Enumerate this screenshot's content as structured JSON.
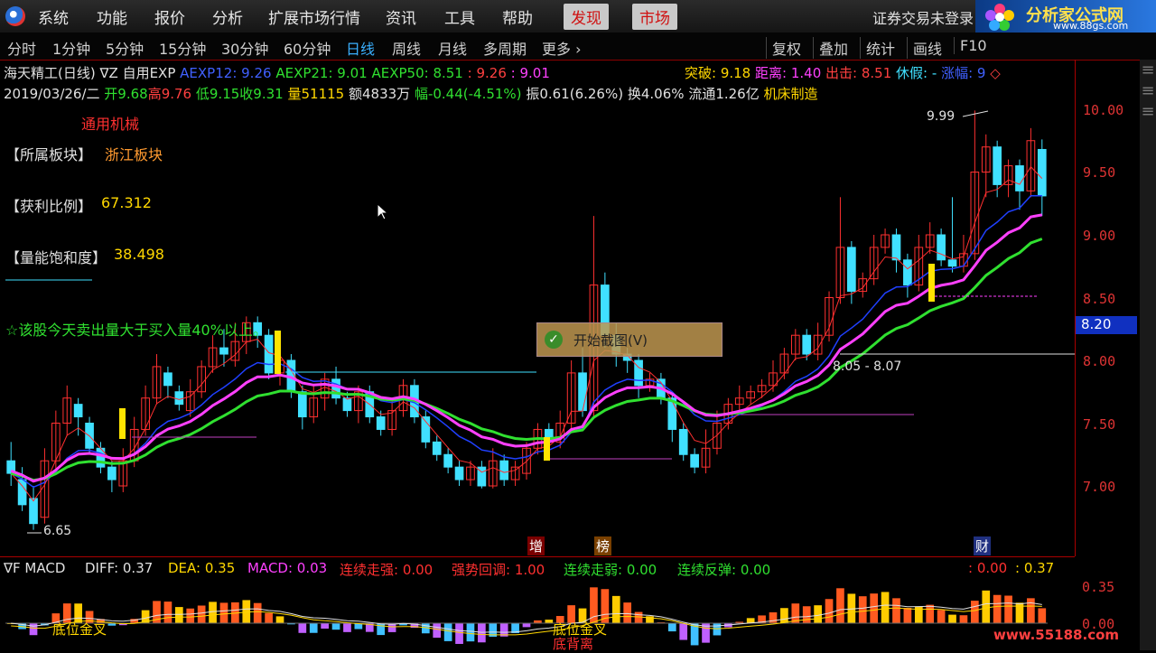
{
  "menubar": {
    "items": [
      "系统",
      "功能",
      "报价",
      "分析",
      "扩展市场行情",
      "资讯",
      "工具",
      "帮助"
    ],
    "highlighted": [
      "发现",
      "市场"
    ],
    "status": "证券交易未登录"
  },
  "brand": {
    "title": "分析家公式网",
    "url": "www.88gs.com"
  },
  "toolbar": {
    "periods": [
      "分时",
      "1分钟",
      "5分钟",
      "15分钟",
      "30分钟",
      "60分钟",
      "日线",
      "周线",
      "月线",
      "多周期",
      "更多 ›"
    ],
    "active": "日线",
    "right": [
      "复权",
      "叠加",
      "统计",
      "画线",
      "F10"
    ]
  },
  "info": {
    "name": "海天精工(日线)",
    "formula": "∇Z 自用EXP",
    "aexp12": "AEXP12: 9.26",
    "aexp21": "AEXP21: 9.01",
    "aexp50": "AEXP50: 8.51",
    "v1": ": 9.26",
    "v2": ": 9.01",
    "breakout": "突破: 9.18",
    "distance": "距离: 1.40",
    "exit": "出击: 8.51",
    "holiday": "休假: -",
    "rise": "涨幅: 9",
    "date": "2019/03/26/二",
    "open": "开9.68",
    "high": "高9.76",
    "low": "低9.15",
    "close": "收9.31",
    "volume": "量51115",
    "amount": "额4833万",
    "change": "幅-0.44(-4.51%)",
    "amp": "振0.61(6.26%)",
    "turnover": "换4.06%",
    "float": "流通1.26亿",
    "industry": "机床制造",
    "sector_tag": "通用机械"
  },
  "labels": {
    "sector": "【所属板块】",
    "sector_val": "浙江板块",
    "profit": "【获利比例】",
    "profit_val": "67.312",
    "vol_sat": "【量能饱和度】",
    "vol_sat_val": "38.498",
    "note": "☆该股今天卖出量大于买入量40%以上。"
  },
  "annotations": {
    "high_label": "9.99",
    "low_label": "6.65",
    "range_label": "8.05 - 8.07",
    "m_add": "增",
    "m_list": "榜",
    "m_fin": "财"
  },
  "price_axis": [
    "10.00",
    "9.50",
    "9.00",
    "8.50",
    "8.00",
    "7.50",
    "7.00"
  ],
  "price_tag": "8.20",
  "popup": {
    "label": "开始截图(V)"
  },
  "macd": {
    "title": "∇F MACD",
    "diff": "DIFF: 0.37",
    "dea": "DEA: 0.35",
    "macd": "MACD: 0.03",
    "s1": "连续走强: 0.00",
    "s2": "强势回调: 1.00",
    "s3": "连续走弱: 0.00",
    "s4": "连续反弹: 0.00",
    "r1": ": 0.00",
    "r2": ": 0.37",
    "ticks": [
      "0.35",
      "0.00"
    ],
    "tag1": "底位金叉",
    "tag2": "底位金叉",
    "tag3": "底背离"
  },
  "watermark": "www.55188.com",
  "colors": {
    "up": "#ff3030",
    "down": "#40e0ff",
    "ma_green": "#30e030",
    "ma_pink": "#ff40ff",
    "ma_blue": "#2040ff"
  },
  "chart_data": {
    "type": "candlestick",
    "ylim": [
      6.5,
      10.2
    ],
    "candles": [
      [
        7.2,
        7.1,
        7.35,
        7.0
      ],
      [
        7.05,
        6.85,
        7.15,
        6.8
      ],
      [
        6.9,
        6.7,
        7.0,
        6.65
      ],
      [
        6.75,
        7.2,
        7.3,
        6.7
      ],
      [
        7.2,
        7.5,
        7.6,
        7.1
      ],
      [
        7.5,
        7.7,
        7.8,
        7.4
      ],
      [
        7.65,
        7.55,
        7.7,
        7.4
      ],
      [
        7.5,
        7.3,
        7.55,
        7.25
      ],
      [
        7.3,
        7.15,
        7.35,
        7.1
      ],
      [
        7.15,
        7.05,
        7.2,
        6.95
      ],
      [
        7.0,
        7.2,
        7.3,
        6.95
      ],
      [
        7.2,
        7.45,
        7.55,
        7.15
      ],
      [
        7.45,
        7.7,
        7.8,
        7.4
      ],
      [
        7.7,
        7.95,
        8.05,
        7.65
      ],
      [
        7.9,
        7.8,
        7.95,
        7.7
      ],
      [
        7.75,
        7.65,
        7.8,
        7.6
      ],
      [
        7.6,
        7.75,
        7.85,
        7.55
      ],
      [
        7.75,
        7.95,
        8.0,
        7.7
      ],
      [
        7.95,
        8.1,
        8.2,
        7.9
      ],
      [
        8.1,
        8.05,
        8.25,
        7.95
      ],
      [
        8.0,
        8.15,
        8.3,
        7.95
      ],
      [
        8.15,
        8.3,
        8.35,
        8.05
      ],
      [
        8.3,
        8.2,
        8.35,
        8.1
      ],
      [
        8.2,
        7.9,
        8.25,
        7.85
      ],
      [
        7.9,
        8.0,
        8.1,
        7.8
      ],
      [
        8.0,
        7.75,
        8.05,
        7.7
      ],
      [
        7.75,
        7.55,
        7.8,
        7.45
      ],
      [
        7.55,
        7.7,
        7.8,
        7.5
      ],
      [
        7.7,
        7.85,
        7.9,
        7.6
      ],
      [
        7.85,
        7.7,
        7.95,
        7.65
      ],
      [
        7.7,
        7.6,
        7.75,
        7.55
      ],
      [
        7.6,
        7.75,
        7.8,
        7.5
      ],
      [
        7.75,
        7.55,
        7.8,
        7.5
      ],
      [
        7.55,
        7.45,
        7.6,
        7.4
      ],
      [
        7.45,
        7.6,
        7.7,
        7.4
      ],
      [
        7.6,
        7.8,
        7.85,
        7.55
      ],
      [
        7.8,
        7.55,
        7.85,
        7.5
      ],
      [
        7.55,
        7.35,
        7.6,
        7.3
      ],
      [
        7.35,
        7.25,
        7.4,
        7.2
      ],
      [
        7.25,
        7.15,
        7.3,
        7.1
      ],
      [
        7.15,
        7.05,
        7.2,
        7.0
      ],
      [
        7.05,
        7.15,
        7.2,
        7.0
      ],
      [
        7.15,
        7.0,
        7.2,
        6.98
      ],
      [
        7.0,
        7.2,
        7.3,
        6.98
      ],
      [
        7.2,
        7.05,
        7.25,
        7.0
      ],
      [
        7.05,
        7.15,
        7.2,
        7.0
      ],
      [
        7.1,
        7.3,
        7.35,
        7.05
      ],
      [
        7.3,
        7.45,
        7.5,
        7.25
      ],
      [
        7.45,
        7.35,
        7.5,
        7.3
      ],
      [
        7.35,
        7.5,
        7.6,
        7.3
      ],
      [
        7.5,
        7.9,
        8.0,
        7.45
      ],
      [
        7.9,
        7.6,
        8.1,
        7.55
      ],
      [
        7.6,
        8.6,
        9.15,
        7.55
      ],
      [
        8.6,
        8.2,
        8.7,
        8.1
      ],
      [
        8.2,
        8.05,
        8.3,
        7.95
      ],
      [
        8.05,
        8.0,
        8.1,
        7.9
      ],
      [
        8.0,
        7.8,
        8.05,
        7.7
      ],
      [
        7.8,
        7.85,
        7.9,
        7.75
      ],
      [
        7.85,
        7.7,
        7.9,
        7.65
      ],
      [
        7.7,
        7.45,
        7.75,
        7.35
      ],
      [
        7.45,
        7.25,
        7.5,
        7.2
      ],
      [
        7.25,
        7.15,
        7.3,
        7.1
      ],
      [
        7.15,
        7.3,
        7.45,
        7.1
      ],
      [
        7.3,
        7.5,
        7.6,
        7.25
      ],
      [
        7.5,
        7.65,
        7.7,
        7.45
      ],
      [
        7.65,
        7.7,
        7.8,
        7.6
      ],
      [
        7.7,
        7.75,
        7.8,
        7.65
      ],
      [
        7.75,
        7.8,
        7.85,
        7.7
      ],
      [
        7.8,
        7.9,
        8.0,
        7.75
      ],
      [
        7.9,
        8.05,
        8.1,
        7.85
      ],
      [
        8.05,
        8.2,
        8.25,
        8.0
      ],
      [
        8.2,
        8.05,
        8.25,
        8.0
      ],
      [
        8.05,
        8.2,
        8.3,
        8.0
      ],
      [
        8.2,
        8.5,
        8.55,
        8.15
      ],
      [
        8.5,
        8.9,
        9.3,
        8.45
      ],
      [
        8.9,
        8.55,
        8.95,
        8.45
      ],
      [
        8.55,
        8.65,
        8.7,
        8.5
      ],
      [
        8.65,
        8.9,
        9.0,
        8.6
      ],
      [
        8.9,
        9.0,
        9.05,
        8.85
      ],
      [
        9.0,
        8.8,
        9.05,
        8.7
      ],
      [
        8.8,
        8.6,
        8.85,
        8.5
      ],
      [
        8.6,
        8.9,
        9.0,
        8.55
      ],
      [
        8.9,
        9.0,
        9.1,
        8.85
      ],
      [
        9.0,
        8.8,
        9.05,
        8.75
      ],
      [
        8.8,
        8.75,
        9.3,
        8.7
      ],
      [
        8.75,
        8.85,
        9.0,
        8.7
      ],
      [
        8.85,
        9.5,
        9.99,
        8.8
      ],
      [
        9.5,
        9.7,
        9.8,
        9.3
      ],
      [
        9.7,
        9.4,
        9.75,
        9.3
      ],
      [
        9.4,
        9.55,
        9.6,
        9.3
      ],
      [
        9.55,
        9.35,
        9.6,
        9.2
      ],
      [
        9.35,
        9.75,
        9.85,
        9.3
      ],
      [
        9.68,
        9.31,
        9.76,
        9.15
      ]
    ]
  }
}
